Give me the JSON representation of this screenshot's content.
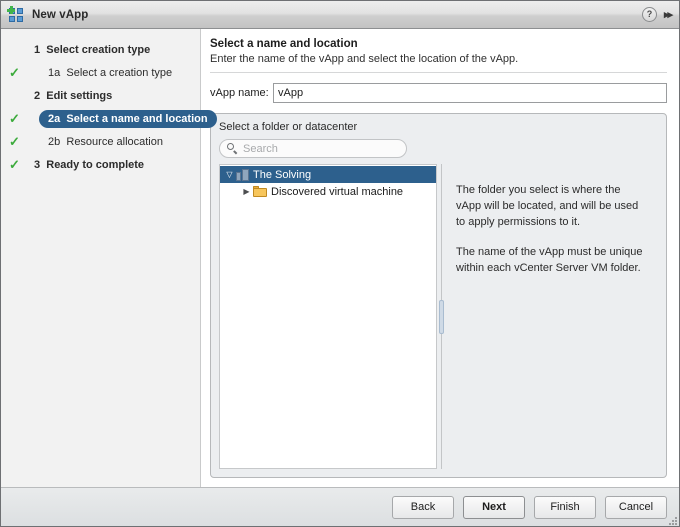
{
  "window": {
    "title": "New vApp",
    "icon": "vapp-icon",
    "help_label": "?",
    "expand_label": "▸▸"
  },
  "sidebar": {
    "items": [
      {
        "checked": false,
        "num": "1",
        "label": "Select creation type",
        "level": 1,
        "selected": false
      },
      {
        "checked": true,
        "num": "1a",
        "label": "Select a creation type",
        "level": 2,
        "selected": false
      },
      {
        "checked": false,
        "num": "2",
        "label": "Edit settings",
        "level": 1,
        "selected": false
      },
      {
        "checked": true,
        "num": "2a",
        "label": "Select a name and location",
        "level": 2,
        "selected": true
      },
      {
        "checked": true,
        "num": "2b",
        "label": "Resource allocation",
        "level": 2,
        "selected": false
      },
      {
        "checked": true,
        "num": "3",
        "label": "Ready to complete",
        "level": 1,
        "selected": false
      }
    ],
    "check_glyph": "✓"
  },
  "main": {
    "title": "Select a name and location",
    "subtitle": "Enter the name of the vApp and select the location of the vApp.",
    "name_label": "vApp name:",
    "name_value": "vApp",
    "name_placeholder": ""
  },
  "selector": {
    "title": "Select a folder or datacenter",
    "search_placeholder": "Search",
    "search_value": "",
    "tree": [
      {
        "label": "The Solving",
        "icon": "datacenter-icon",
        "twisty": "▽",
        "selected": true,
        "level": 0
      },
      {
        "label": "Discovered virtual machine",
        "icon": "folder-icon",
        "twisty": "▶",
        "selected": false,
        "level": 1
      }
    ],
    "info": [
      "The folder you select is where the vApp will be located, and will be used to apply permissions to it.",
      "The name of the vApp must be unique within each vCenter Server VM folder."
    ]
  },
  "footer": {
    "buttons": [
      {
        "label": "Back",
        "default": false
      },
      {
        "label": "Next",
        "default": true
      },
      {
        "label": "Finish",
        "default": false
      },
      {
        "label": "Cancel",
        "default": false
      }
    ]
  },
  "colors": {
    "selection_blue": "#2d608d",
    "check_green": "#3cab3c",
    "folder_yellow": "#f7c65c",
    "titlebar_grey": "#d5d5d5"
  }
}
